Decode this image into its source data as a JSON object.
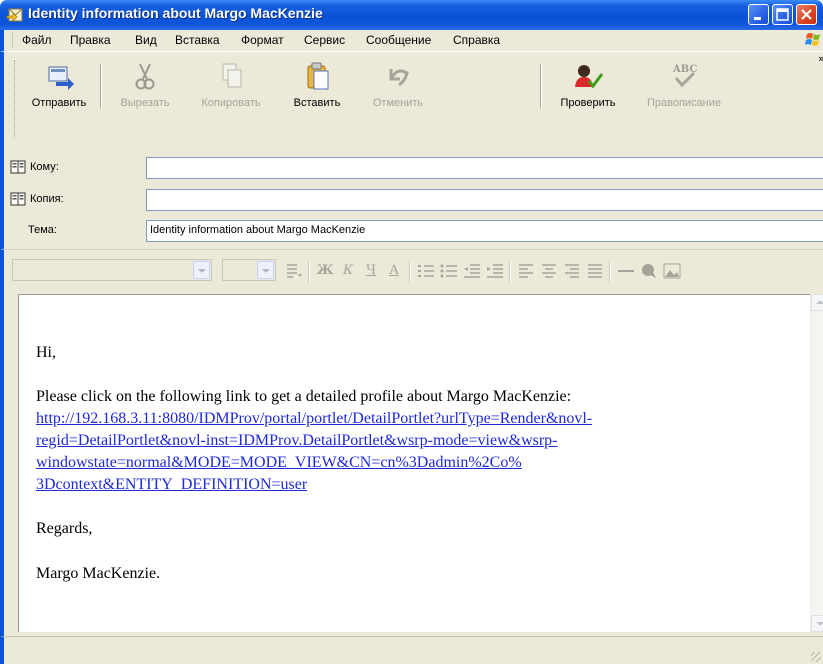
{
  "window": {
    "title": "Identity information about Margo MacKenzie",
    "accent": "#0a52d6",
    "close_color": "#d9441f"
  },
  "menu": {
    "items": [
      "Файл",
      "Правка",
      "Вид",
      "Вставка",
      "Формат",
      "Сервис",
      "Сообщение",
      "Справка"
    ]
  },
  "toolbar": {
    "send": "Отправить",
    "cut": "Вырезать",
    "copy": "Копировать",
    "paste": "Вставить",
    "undo": "Отменить",
    "check": "Проверить",
    "spelling": "Правописание",
    "more": "»"
  },
  "fields": {
    "to_label": "Кому:",
    "to_value": "",
    "cc_label": "Копия:",
    "cc_value": "",
    "subject_label": "Тема:",
    "subject_value": "Identity information about Margo MacKenzie"
  },
  "format": {
    "font_value": "",
    "size_value": "",
    "bold": "Ж",
    "italic": "К",
    "underline": "Ч",
    "font_color": "А"
  },
  "message": {
    "greeting": "Hi,",
    "intro": "Please click on the following link to get a detailed profile about Margo MacKenzie:",
    "link_lines": [
      "http://192.168.3.11:8080/IDMProv/portal/portlet/DetailPortlet?urlType=Render&novl-",
      "regid=DetailPortlet&novl-inst=IDMProv.DetailPortlet&wsrp-mode=view&wsrp-",
      "windowstate=normal&MODE=MODE_VIEW&CN=cn%3Dadmin%2Co%",
      "3Dcontext&ENTITY_DEFINITION=user"
    ],
    "closing": "Regards,",
    "signature": "Margo MacKenzie."
  }
}
